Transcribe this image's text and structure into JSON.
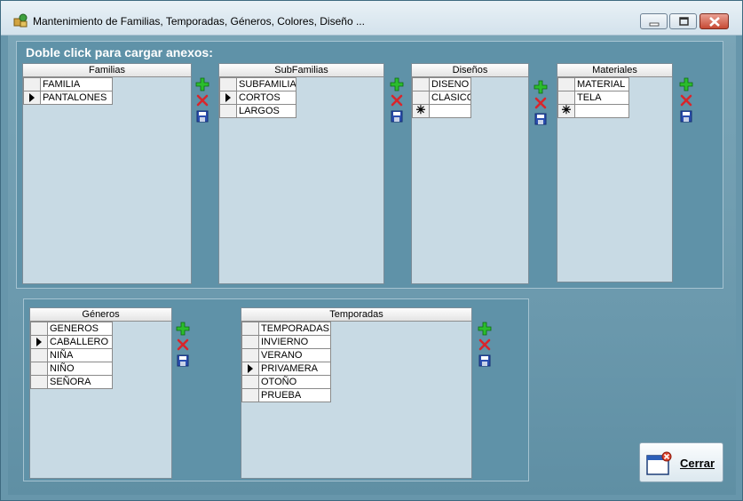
{
  "window": {
    "title": "Mantenimiento de Familias, Temporadas, Géneros, Colores, Diseño ..."
  },
  "hint": "Doble click para cargar anexos:",
  "grids": {
    "familias": {
      "header": "Familias",
      "rows": [
        "FAMILIA",
        "PANTALONES"
      ],
      "current": 1,
      "new_row": false
    },
    "subfamilias": {
      "header": "SubFamilias",
      "rows": [
        "SUBFAMILIA",
        "CORTOS",
        "LARGOS"
      ],
      "current": 1,
      "new_row": false
    },
    "disenos": {
      "header": "Diseños",
      "rows": [
        "DISENO",
        "CLASICO"
      ],
      "current": -1,
      "new_row": true
    },
    "materiales": {
      "header": "Materiales",
      "rows": [
        "MATERIAL",
        "TELA"
      ],
      "current": -1,
      "new_row": true
    },
    "generos": {
      "header": "Géneros",
      "rows": [
        "GENEROS",
        "CABALLERO",
        "NIÑA",
        "NIÑO",
        "SEÑORA"
      ],
      "current": 1,
      "new_row": false
    },
    "temporadas": {
      "header": "Temporadas",
      "rows": [
        "TEMPORADAS",
        "INVIERNO",
        "VERANO",
        "PRIVAMERA",
        "OTOÑO",
        "PRUEBA"
      ],
      "current": 3,
      "new_row": false
    }
  },
  "icons": {
    "add": "plus-icon",
    "delete": "x-icon",
    "save": "floppy-icon"
  },
  "colors": {
    "add_green": "#27b52a",
    "delete_red": "#d9252b",
    "save_blue": "#2b4fb0"
  },
  "buttons": {
    "close_label": "Cerrar"
  }
}
